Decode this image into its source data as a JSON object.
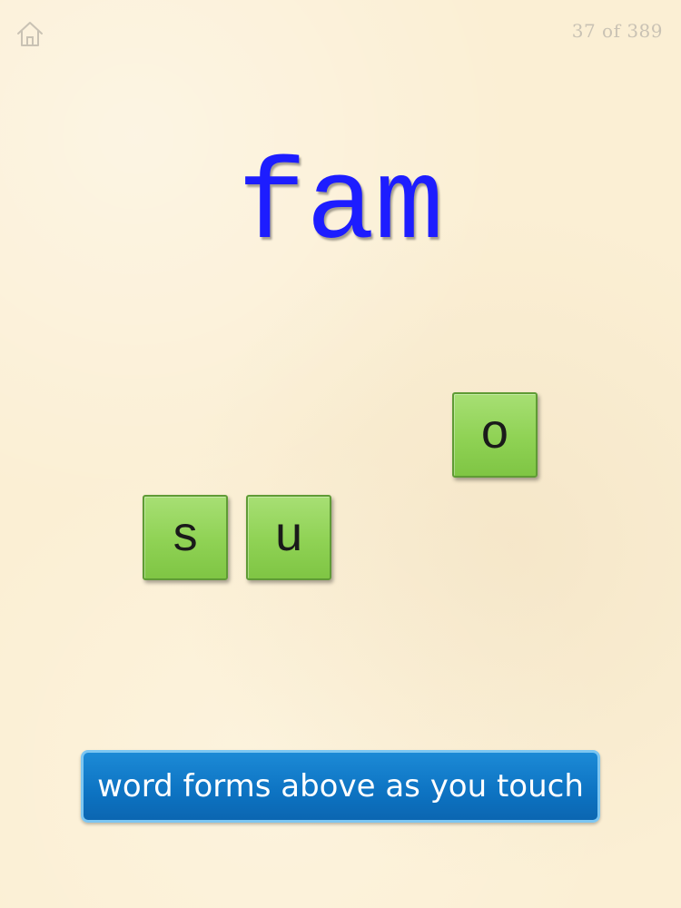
{
  "header": {
    "home_icon": "home-icon",
    "counter": "37 of 389"
  },
  "main": {
    "target_word": "fam",
    "tiles": [
      {
        "letter": "s"
      },
      {
        "letter": "u"
      },
      {
        "letter": "o"
      }
    ]
  },
  "footer": {
    "hint_button_label": "word forms above as you touch"
  },
  "colors": {
    "background": "#fbefd4",
    "word": "#1d1dff",
    "tile_fill": "#8fd254",
    "hint_button": "#0d73c2"
  }
}
